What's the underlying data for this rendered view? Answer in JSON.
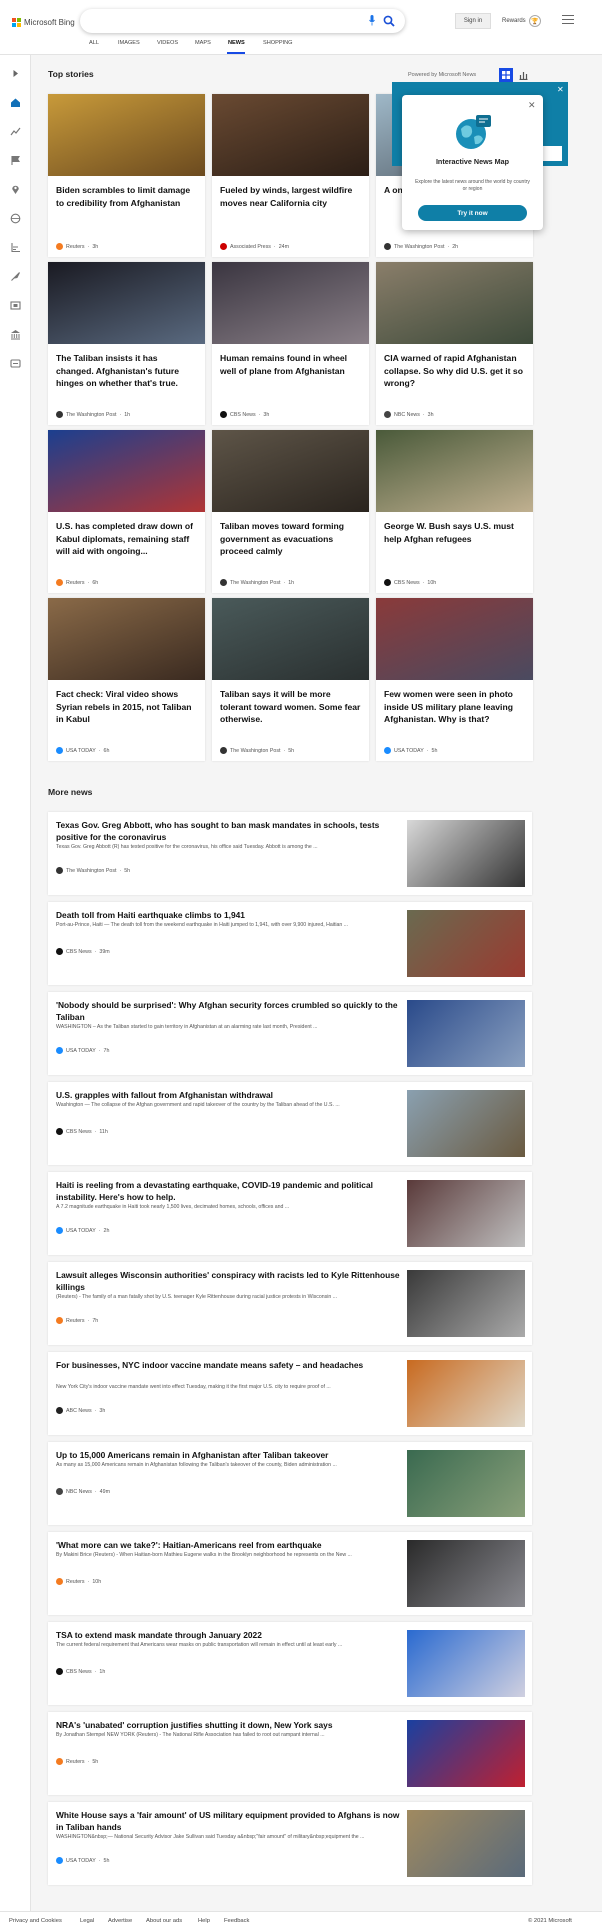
{
  "header": {
    "logo_text": "Microsoft Bing",
    "signin_label": "Sign in",
    "rewards_label": "Rewards",
    "tabs": [
      "ALL",
      "IMAGES",
      "VIDEOS",
      "MAPS",
      "NEWS",
      "SHOPPING"
    ],
    "active_tab": "NEWS"
  },
  "top_stories": {
    "heading": "Top stories",
    "powered_by": "Powered by Microsoft News",
    "cards": [
      {
        "title": "Biden scrambles to limit damage to credibility from Afghanistan",
        "source": "Reuters",
        "age": "3h",
        "source_color": "#f47b20"
      },
      {
        "title": "Fueled by winds, largest wildfire moves near California city",
        "source": "Associated Press",
        "age": "24m",
        "source_color": "#cc0000"
      },
      {
        "title": "A one ... retur... next",
        "source": "The Washington Post",
        "age": "2h",
        "source_color": "#333333"
      },
      {
        "title": "The Taliban insists it has changed. Afghanistan's future hinges on whether that's true.",
        "source": "The Washington Post",
        "age": "1h",
        "source_color": "#333333"
      },
      {
        "title": "Human remains found in wheel well of plane from Afghanistan",
        "source": "CBS News",
        "age": "3h",
        "source_color": "#111111"
      },
      {
        "title": "CIA warned of rapid Afghanistan collapse. So why did U.S. get it so wrong?",
        "source": "NBC News",
        "age": "3h",
        "source_color": "#444444"
      },
      {
        "title": "U.S. has completed draw down of Kabul diplomats, remaining staff will aid with ongoing...",
        "source": "Reuters",
        "age": "6h",
        "source_color": "#f47b20"
      },
      {
        "title": "Taliban moves toward forming government as evacuations proceed calmly",
        "source": "The Washington Post",
        "age": "1h",
        "source_color": "#333333"
      },
      {
        "title": "George W. Bush says U.S. must help Afghan refugees",
        "source": "CBS News",
        "age": "10h",
        "source_color": "#111111"
      },
      {
        "title": "Fact check: Viral video shows Syrian rebels in 2015, not Taliban in Kabul",
        "source": "USA TODAY",
        "age": "6h",
        "source_color": "#1a8cff"
      },
      {
        "title": "Taliban says it will be more tolerant toward women. Some fear otherwise.",
        "source": "The Washington Post",
        "age": "5h",
        "source_color": "#333333"
      },
      {
        "title": "Few women were seen in photo inside US military plane leaving Afghanistan. Why is that?",
        "source": "USA TODAY",
        "age": "5h",
        "source_color": "#1a8cff"
      }
    ]
  },
  "popup": {
    "title": "Interactive News Map",
    "description": "Explore the latest news around the world by country or region",
    "button": "Try it now",
    "close": "✕"
  },
  "more_news": {
    "heading": "More news",
    "items": [
      {
        "title": "Texas Gov. Greg Abbott, who has sought to ban mask mandates in schools, tests positive for the coronavirus",
        "snippet": "Texas Gov. Greg Abbott (R) has tested positive for the coronavirus, his office said Tuesday. Abbott is among the ...",
        "source": "The Washington Post",
        "age": "5h",
        "source_color": "#333333"
      },
      {
        "title": "Death toll from Haiti earthquake climbs to 1,941",
        "snippet": "Port-au-Prince, Haiti — The death toll from the weekend earthquake in Haiti jumped to 1,941, with over 9,900 injured, Haitian ...",
        "source": "CBS News",
        "age": "39m",
        "source_color": "#111111"
      },
      {
        "title": "'Nobody should be surprised': Why Afghan security forces crumbled so quickly to the Taliban",
        "snippet": "WASHINGTON – As the Taliban started to gain territory in Afghanistan at an alarming rate last month, President ...",
        "source": "USA TODAY",
        "age": "7h",
        "source_color": "#1a8cff"
      },
      {
        "title": "U.S. grapples with fallout from Afghanistan withdrawal",
        "snippet": "Washington — The collapse of the Afghan government and rapid takeover of the country by the Taliban ahead of the U.S. ...",
        "source": "CBS News",
        "age": "11h",
        "source_color": "#111111"
      },
      {
        "title": "Haiti is reeling from a devastating earthquake, COVID-19 pandemic and political instability. Here's how to help.",
        "snippet": "A 7.2 magnitude earthquake in Haiti took nearly 1,500 lives, decimated homes, schools, offices and ...",
        "source": "USA TODAY",
        "age": "2h",
        "source_color": "#1a8cff"
      },
      {
        "title": "Lawsuit alleges Wisconsin authorities' conspiracy with racists led to Kyle Rittenhouse killings",
        "snippet": "(Reuters) - The family of a man fatally shot by U.S. teenager Kyle Rittenhouse during racial justice protests in Wisconsin ...",
        "source": "Reuters",
        "age": "7h",
        "source_color": "#f47b20"
      },
      {
        "title": "For businesses, NYC indoor vaccine mandate means safety – and headaches",
        "snippet": "New York City's indoor vaccine mandate went into effect Tuesday, making it the first major U.S. city to require proof of ...",
        "source": "ABC News",
        "age": "3h",
        "source_color": "#222222"
      },
      {
        "title": "Up to 15,000 Americans remain in Afghanistan after Taliban takeover",
        "snippet": "As many as 15,000 Americans remain in Afghanistan following the Taliban's takeover of the county, Biden administration ...",
        "source": "NBC News",
        "age": "49m",
        "source_color": "#444444"
      },
      {
        "title": "'What more can we take?': Haitian-Americans reel from earthquake",
        "snippet": "By Makini Brice (Reuters) - When Haitian-born Mathieu Eugene walks in the Brooklyn neighborhood he represents on the New ...",
        "source": "Reuters",
        "age": "10h",
        "source_color": "#f47b20"
      },
      {
        "title": "TSA to extend mask mandate through January 2022",
        "snippet": "The current federal requirement that Americans wear masks on public transportation will remain in effect until at least early ...",
        "source": "CBS News",
        "age": "1h",
        "source_color": "#111111"
      },
      {
        "title": "NRA's 'unabated' corruption justifies shutting it down, New York says",
        "snippet": "By Jonathan Stempel NEW YORK (Reuters) - The National Rifle Association has failed to root out rampant internal ...",
        "source": "Reuters",
        "age": "5h",
        "source_color": "#f47b20"
      },
      {
        "title": "White House says a 'fair amount' of US military equipment provided to Afghans is now in Taliban hands",
        "snippet": "WASHINGTON&nbsp;— National Security Advisor Jake Sullivan said Tuesday a&nbsp;\"fair amount\" of military&nbsp;equipment the ...",
        "source": "USA TODAY",
        "age": "5h",
        "source_color": "#1a8cff"
      }
    ]
  },
  "footer": {
    "links": [
      "Privacy and Cookies",
      "Legal",
      "Advertise",
      "About our ads",
      "Help",
      "Feedback"
    ],
    "copyright": "© 2021 Microsoft"
  }
}
